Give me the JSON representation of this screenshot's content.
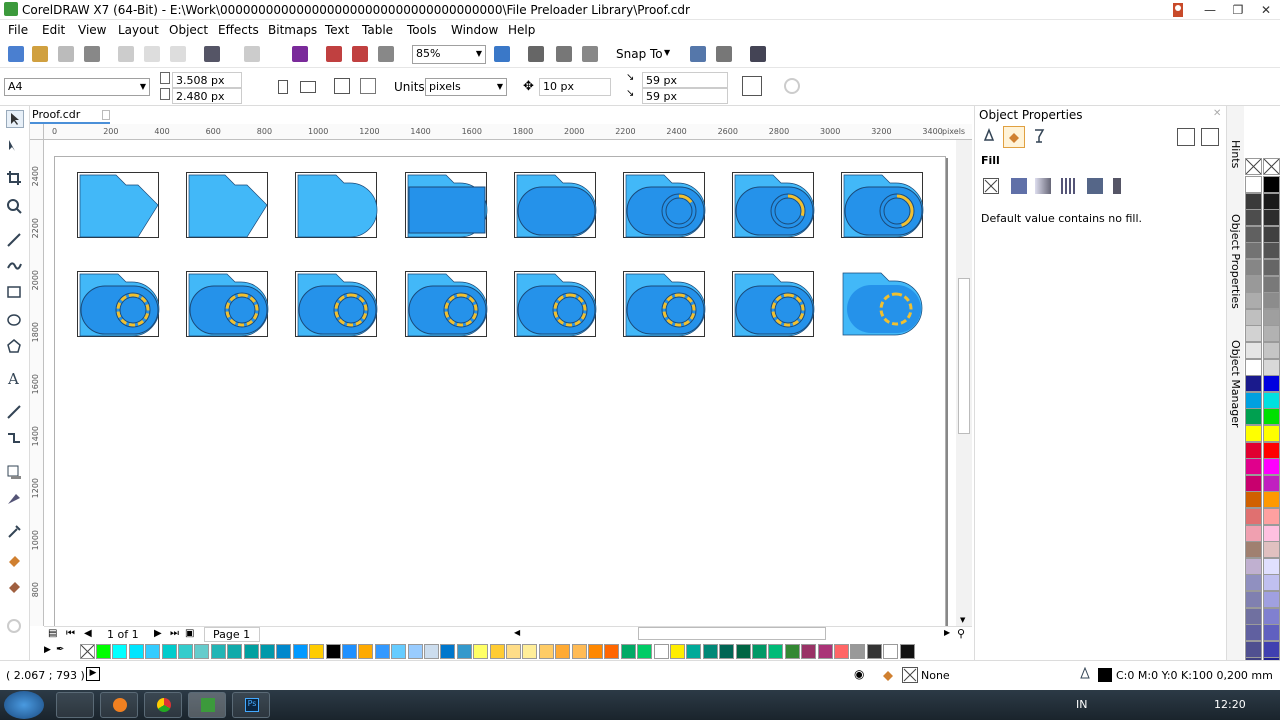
{
  "window": {
    "title": "CorelDRAW X7 (64-Bit) - E:\\Work\\0000000000000000000000000000000000000\\File Preloader Library\\Proof.cdr"
  },
  "menu": [
    "File",
    "Edit",
    "View",
    "Layout",
    "Object",
    "Effects",
    "Bitmaps",
    "Text",
    "Table",
    "Tools",
    "Window",
    "Help"
  ],
  "toolbar": {
    "zoom": "85%",
    "snap_to": "Snap To"
  },
  "propbar": {
    "page_size": "A4",
    "width": "3.508 px",
    "height": "2.480 px",
    "units_label": "Units:",
    "units": "pixels",
    "nudge": "10 px",
    "dup_x": "59 px",
    "dup_y": "59 px"
  },
  "document": {
    "tab": "Proof.cdr",
    "ruler_unit": "pixels",
    "h_ticks": [
      "0",
      "200",
      "400",
      "600",
      "800",
      "1000",
      "1200",
      "1400",
      "1600",
      "1800",
      "2000",
      "2200",
      "2400",
      "2600",
      "2800",
      "3000",
      "3200",
      "3400"
    ],
    "v_ticks": [
      "2400",
      "2200",
      "2000",
      "1800",
      "1600",
      "1400",
      "1200",
      "1000",
      "800"
    ]
  },
  "icons": [
    {
      "stage": 1,
      "ring": 0
    },
    {
      "stage": 2,
      "ring": 0
    },
    {
      "stage": 3,
      "ring": 0
    },
    {
      "stage": 4,
      "ring": 0
    },
    {
      "stage": 5,
      "ring": 0
    },
    {
      "stage": 6,
      "ring": 0.15
    },
    {
      "stage": 7,
      "ring": 0.3
    },
    {
      "stage": 8,
      "ring": 0.45
    },
    {
      "stage": 9,
      "ring": 1
    },
    {
      "stage": 9,
      "ring": 1
    },
    {
      "stage": 9,
      "ring": 1
    },
    {
      "stage": 9,
      "ring": 1
    },
    {
      "stage": 9,
      "ring": 1
    },
    {
      "stage": 10,
      "ring": 1
    },
    {
      "stage": 10,
      "ring": 1
    },
    {
      "stage": 11,
      "ring": 1
    }
  ],
  "pagenav": {
    "count": "1 of 1",
    "page": "Page 1"
  },
  "dock": {
    "title": "Object Properties",
    "section": "Fill",
    "message": "Default value contains no fill.",
    "tabs": [
      "Hints",
      "Object Properties",
      "Object Manager"
    ]
  },
  "status": {
    "coords": "( 2.067 ; 793   )",
    "fill_none": "None",
    "outline": "C:0 M:0 Y:0 K:100  0,200 mm"
  },
  "taskbar": {
    "lang": "IN",
    "time": "12:20"
  },
  "palette_colors": [
    "#00ff00",
    "#00ffff",
    "#00e5ff",
    "#33ccff",
    "#00cccc",
    "#33cccc",
    "#66cccc",
    "#22b5b5",
    "#11aaaa",
    "#00a0a0",
    "#0099aa",
    "#0088cc",
    "#0099ff",
    "#ffcc00",
    "#000000",
    "#1e90ff",
    "#ffaa00",
    "#3399ff",
    "#66ccff",
    "#99ccff",
    "#ccddee",
    "#0077cc",
    "#3399cc",
    "#ffff66",
    "#ffcc33",
    "#ffdd88",
    "#ffee99",
    "#ffcc66",
    "#ffaa33",
    "#ffbb55",
    "#ff8800",
    "#ff6600",
    "#00aa66",
    "#00cc66",
    "#ffffff",
    "#ffee00",
    "#00aa99",
    "#008877",
    "#006655",
    "#006644",
    "#009966",
    "#00bb77",
    "#338833",
    "#993366",
    "#aa3377",
    "#ff6666",
    "#999999",
    "#333333",
    "#ffffff",
    "#111111"
  ],
  "vpalette_left": [
    "#ffffff",
    "#3a3a3a",
    "#4d4d4d",
    "#606060",
    "#737373",
    "#868686",
    "#999999",
    "#acacac",
    "#bfbfbf",
    "#d2d2d2",
    "#e5e5e5",
    "#ffffff",
    "#1a1a8c",
    "#00a0e0",
    "#00a050",
    "#ffff00",
    "#e00030",
    "#e0008c",
    "#c8006e",
    "#d06000",
    "#e07070",
    "#f0a0b0",
    "#a08070",
    "#c0b0d0",
    "#9090c0",
    "#8080b0",
    "#7070a0",
    "#6060a0",
    "#505090",
    "#404080"
  ],
  "vpalette_right": [
    "#000000",
    "#1a1a1a",
    "#2d2d2d",
    "#404040",
    "#535353",
    "#666666",
    "#797979",
    "#8c8c8c",
    "#9f9f9f",
    "#b2b2b2",
    "#c5c5c5",
    "#d8d8d8",
    "#0000e0",
    "#00e0e0",
    "#00e000",
    "#ffff00",
    "#ff0000",
    "#ff00ff",
    "#c020c0",
    "#ff9900",
    "#ffa0a0",
    "#ffc0e0",
    "#e0c0c0",
    "#e0e0ff",
    "#c0c0f0",
    "#a0a0e0",
    "#8080d0",
    "#6060c0",
    "#4040b0",
    "#202090"
  ]
}
